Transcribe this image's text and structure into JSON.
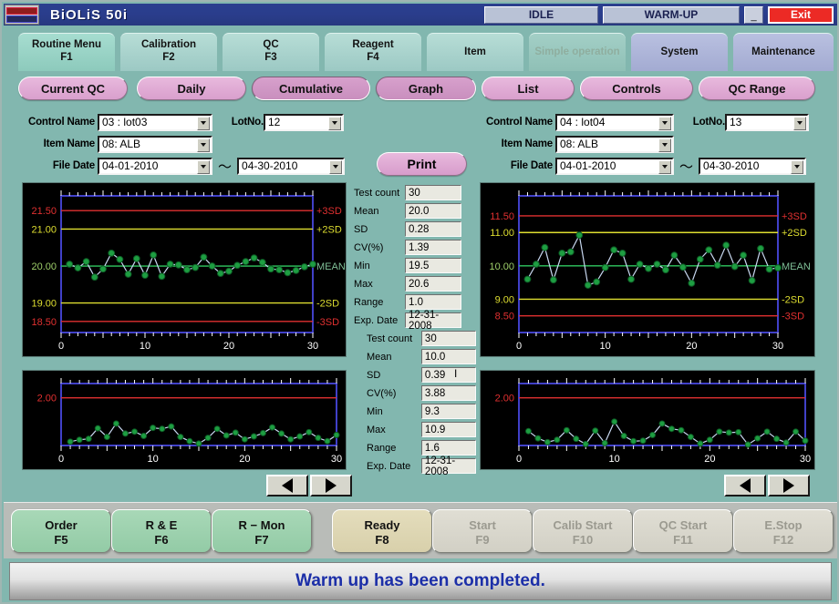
{
  "titlebar": {
    "app_title": "BiOLiS  50i",
    "status_left": "IDLE",
    "status_right": "WARM-UP",
    "minimize_label": "_",
    "exit_label": "Exit"
  },
  "tabs": [
    {
      "line1": "Routine Menu",
      "line2": "F1",
      "style": "green"
    },
    {
      "line1": "Calibration",
      "line2": "F2",
      "style": "green2"
    },
    {
      "line1": "QC",
      "line2": "F3",
      "style": "green2"
    },
    {
      "line1": "Reagent",
      "line2": "F4",
      "style": "green2"
    },
    {
      "line1": "Item",
      "line2": "",
      "style": "green2"
    },
    {
      "line1": "Simple operation",
      "line2": "",
      "style": "dim"
    },
    {
      "line1": "System",
      "line2": "",
      "style": "blue"
    },
    {
      "line1": "Maintenance",
      "line2": "",
      "style": "blue"
    }
  ],
  "subtabs": [
    {
      "label": "Current QC",
      "selected": false
    },
    {
      "label": "Daily",
      "selected": false
    },
    {
      "label": "Cumulative",
      "selected": true
    },
    {
      "label": "Graph",
      "selected": true
    },
    {
      "label": "List",
      "selected": false
    },
    {
      "label": "Controls",
      "selected": false
    },
    {
      "label": "QC Range",
      "selected": false
    }
  ],
  "print_button": "Print",
  "left_form": {
    "control_name_label": "Control Name",
    "control_name_value": "03 : lot03",
    "lotno_label": "LotNo.",
    "lotno_value": "12",
    "item_name_label": "Item Name",
    "item_name_value": "08: ALB",
    "file_date_label": "File  Date",
    "file_date_from": "04-01-2010",
    "file_date_sep": "～",
    "file_date_to": "04-30-2010"
  },
  "right_form": {
    "control_name_label": "Control Name",
    "control_name_value": "04 : lot04",
    "lotno_label": "LotNo.",
    "lotno_value": "13",
    "item_name_label": "Item Name",
    "item_name_value": "08: ALB",
    "file_date_label": "File  Date",
    "file_date_from": "04-01-2010",
    "file_date_sep": "～",
    "file_date_to": "04-30-2010"
  },
  "stats_left": {
    "rows": [
      {
        "name": "Test count",
        "value": "30"
      },
      {
        "name": "Mean",
        "value": "20.0"
      },
      {
        "name": "SD",
        "value": "0.28"
      },
      {
        "name": "CV(%)",
        "value": "1.39"
      },
      {
        "name": "Min",
        "value": "19.5"
      },
      {
        "name": "Max",
        "value": "20.6"
      },
      {
        "name": "Range",
        "value": "1.0"
      },
      {
        "name": "Exp. Date",
        "value": "12-31-2008"
      }
    ]
  },
  "stats_right": {
    "rows": [
      {
        "name": "Test count",
        "value": "30"
      },
      {
        "name": "Mean",
        "value": "10.0"
      },
      {
        "name": "SD",
        "value": "0.39"
      },
      {
        "name": "CV(%)",
        "value": "3.88"
      },
      {
        "name": "Min",
        "value": "9.3"
      },
      {
        "name": "Max",
        "value": "10.9"
      },
      {
        "name": "Range",
        "value": "1.6"
      },
      {
        "name": "Exp. Date",
        "value": "12-31-2008"
      }
    ]
  },
  "nav": {
    "prev_label": "◀",
    "next_label": "▶"
  },
  "function_buttons": [
    {
      "line1": "Order",
      "line2": "F5",
      "style": "green"
    },
    {
      "line1": "R & E",
      "line2": "F6",
      "style": "green"
    },
    {
      "line1": "R − Mon",
      "line2": "F7",
      "style": "green"
    },
    {
      "line1": "Ready",
      "line2": "F8",
      "style": "cream"
    },
    {
      "line1": "Start",
      "line2": "F9",
      "style": "gray"
    },
    {
      "line1": "Calib Start",
      "line2": "F10",
      "style": "gray"
    },
    {
      "line1": "QC Start",
      "line2": "F11",
      "style": "gray"
    },
    {
      "line1": "E.Stop",
      "line2": "F12",
      "style": "gray"
    }
  ],
  "message": "Warm up has been completed.",
  "colors": {
    "sd3": "#e03030",
    "sd2": "#dede30",
    "mean": "#30c860",
    "marker": "#1e9e42",
    "line": "#c8d8f0",
    "frame": "#4040c8",
    "tick": "#ffffff"
  },
  "chart_data": [
    {
      "id": "left-levey-jennings",
      "type": "line",
      "title": "",
      "xlabel": "",
      "ylabel": "",
      "xlim": [
        0,
        30
      ],
      "xticks": [
        0,
        10,
        20,
        30
      ],
      "ylim": [
        18.2,
        21.9
      ],
      "ytick_labels": [
        "21.50",
        "21.00",
        "20.00",
        "19.00",
        "18.50"
      ],
      "ytick_values": [
        21.5,
        21.0,
        20.0,
        19.0,
        18.5
      ],
      "limit_lines": [
        {
          "label": "+3SD",
          "value": 21.5,
          "color": "#e03030"
        },
        {
          "label": "+2SD",
          "value": 21.0,
          "color": "#dede30"
        },
        {
          "label": "MEAN",
          "value": 20.0,
          "color": "#30c860"
        },
        {
          "label": "-2SD",
          "value": 19.0,
          "color": "#dede30"
        },
        {
          "label": "-3SD",
          "value": 18.5,
          "color": "#e03030"
        }
      ],
      "x": [
        1,
        2,
        3,
        4,
        5,
        6,
        7,
        8,
        9,
        10,
        11,
        12,
        13,
        14,
        15,
        16,
        17,
        18,
        19,
        20,
        21,
        22,
        23,
        24,
        25,
        26,
        27,
        28,
        29,
        30
      ],
      "values": [
        20.05,
        19.95,
        20.12,
        19.7,
        19.92,
        20.35,
        20.18,
        19.78,
        20.2,
        19.75,
        20.3,
        19.72,
        20.05,
        20.03,
        19.9,
        19.96,
        20.24,
        20.0,
        19.8,
        19.86,
        20.02,
        20.12,
        20.22,
        20.1,
        19.92,
        19.9,
        19.82,
        19.88,
        19.98,
        20.05
      ]
    },
    {
      "id": "left-abs-delta",
      "type": "line",
      "ylim": [
        0,
        2.6
      ],
      "ytick_labels": [
        "2.00"
      ],
      "ytick_values": [
        2.0
      ],
      "xlim": [
        0,
        30
      ],
      "xticks": [
        0,
        10,
        20,
        30
      ],
      "limit_lines": [
        {
          "label": "",
          "value": 2.0,
          "color": "#e03030"
        }
      ],
      "x": [
        1,
        2,
        3,
        4,
        5,
        6,
        7,
        8,
        9,
        10,
        11,
        12,
        13,
        14,
        15,
        16,
        17,
        18,
        19,
        20,
        21,
        22,
        23,
        24,
        25,
        26,
        27,
        28,
        29,
        30
      ],
      "values": [
        0.16,
        0.24,
        0.28,
        0.72,
        0.36,
        0.92,
        0.5,
        0.58,
        0.4,
        0.74,
        0.7,
        0.8,
        0.36,
        0.18,
        0.08,
        0.32,
        0.7,
        0.42,
        0.54,
        0.26,
        0.38,
        0.52,
        0.76,
        0.5,
        0.26,
        0.38,
        0.56,
        0.32,
        0.18,
        0.44
      ]
    },
    {
      "id": "right-levey-jennings",
      "type": "line",
      "xlim": [
        0,
        30
      ],
      "xticks": [
        0,
        10,
        20,
        30
      ],
      "ylim": [
        8.0,
        12.1
      ],
      "ytick_labels": [
        "11.50",
        "11.00",
        "10.00",
        "9.00",
        "8.50"
      ],
      "ytick_values": [
        11.5,
        11.0,
        10.0,
        9.0,
        8.5
      ],
      "limit_lines": [
        {
          "label": "+3SD",
          "value": 11.5,
          "color": "#e03030"
        },
        {
          "label": "+2SD",
          "value": 11.0,
          "color": "#dede30"
        },
        {
          "label": "MEAN",
          "value": 10.0,
          "color": "#30c860"
        },
        {
          "label": "-2SD",
          "value": 9.0,
          "color": "#dede30"
        },
        {
          "label": "-3SD",
          "value": 8.5,
          "color": "#e03030"
        }
      ],
      "x": [
        1,
        2,
        3,
        4,
        5,
        6,
        7,
        8,
        9,
        10,
        11,
        12,
        13,
        14,
        15,
        16,
        17,
        18,
        19,
        20,
        21,
        22,
        23,
        24,
        25,
        26,
        27,
        28,
        29,
        30
      ],
      "values": [
        9.6,
        10.05,
        10.55,
        9.58,
        10.38,
        10.42,
        10.92,
        9.42,
        9.52,
        9.95,
        10.48,
        10.38,
        9.6,
        10.05,
        9.92,
        10.05,
        9.88,
        10.32,
        9.96,
        9.48,
        10.2,
        10.48,
        10.02,
        10.62,
        9.98,
        10.32,
        9.56,
        10.52,
        9.9,
        9.94
      ]
    },
    {
      "id": "right-abs-delta",
      "type": "line",
      "ylim": [
        0,
        2.6
      ],
      "ytick_labels": [
        "2.00"
      ],
      "ytick_values": [
        2.0
      ],
      "xlim": [
        0,
        30
      ],
      "xticks": [
        0,
        10,
        20,
        30
      ],
      "limit_lines": [
        {
          "label": "",
          "value": 2.0,
          "color": "#e03030"
        }
      ],
      "x": [
        1,
        2,
        3,
        4,
        5,
        6,
        7,
        8,
        9,
        10,
        11,
        12,
        13,
        14,
        15,
        16,
        17,
        18,
        19,
        20,
        21,
        22,
        23,
        24,
        25,
        26,
        27,
        28,
        29,
        30
      ],
      "values": [
        0.6,
        0.3,
        0.14,
        0.24,
        0.64,
        0.28,
        0.06,
        0.62,
        0.1,
        1.0,
        0.4,
        0.18,
        0.2,
        0.44,
        0.92,
        0.7,
        0.64,
        0.36,
        0.08,
        0.24,
        0.58,
        0.54,
        0.56,
        0.04,
        0.3,
        0.58,
        0.28,
        0.12,
        0.58,
        0.2
      ]
    }
  ]
}
